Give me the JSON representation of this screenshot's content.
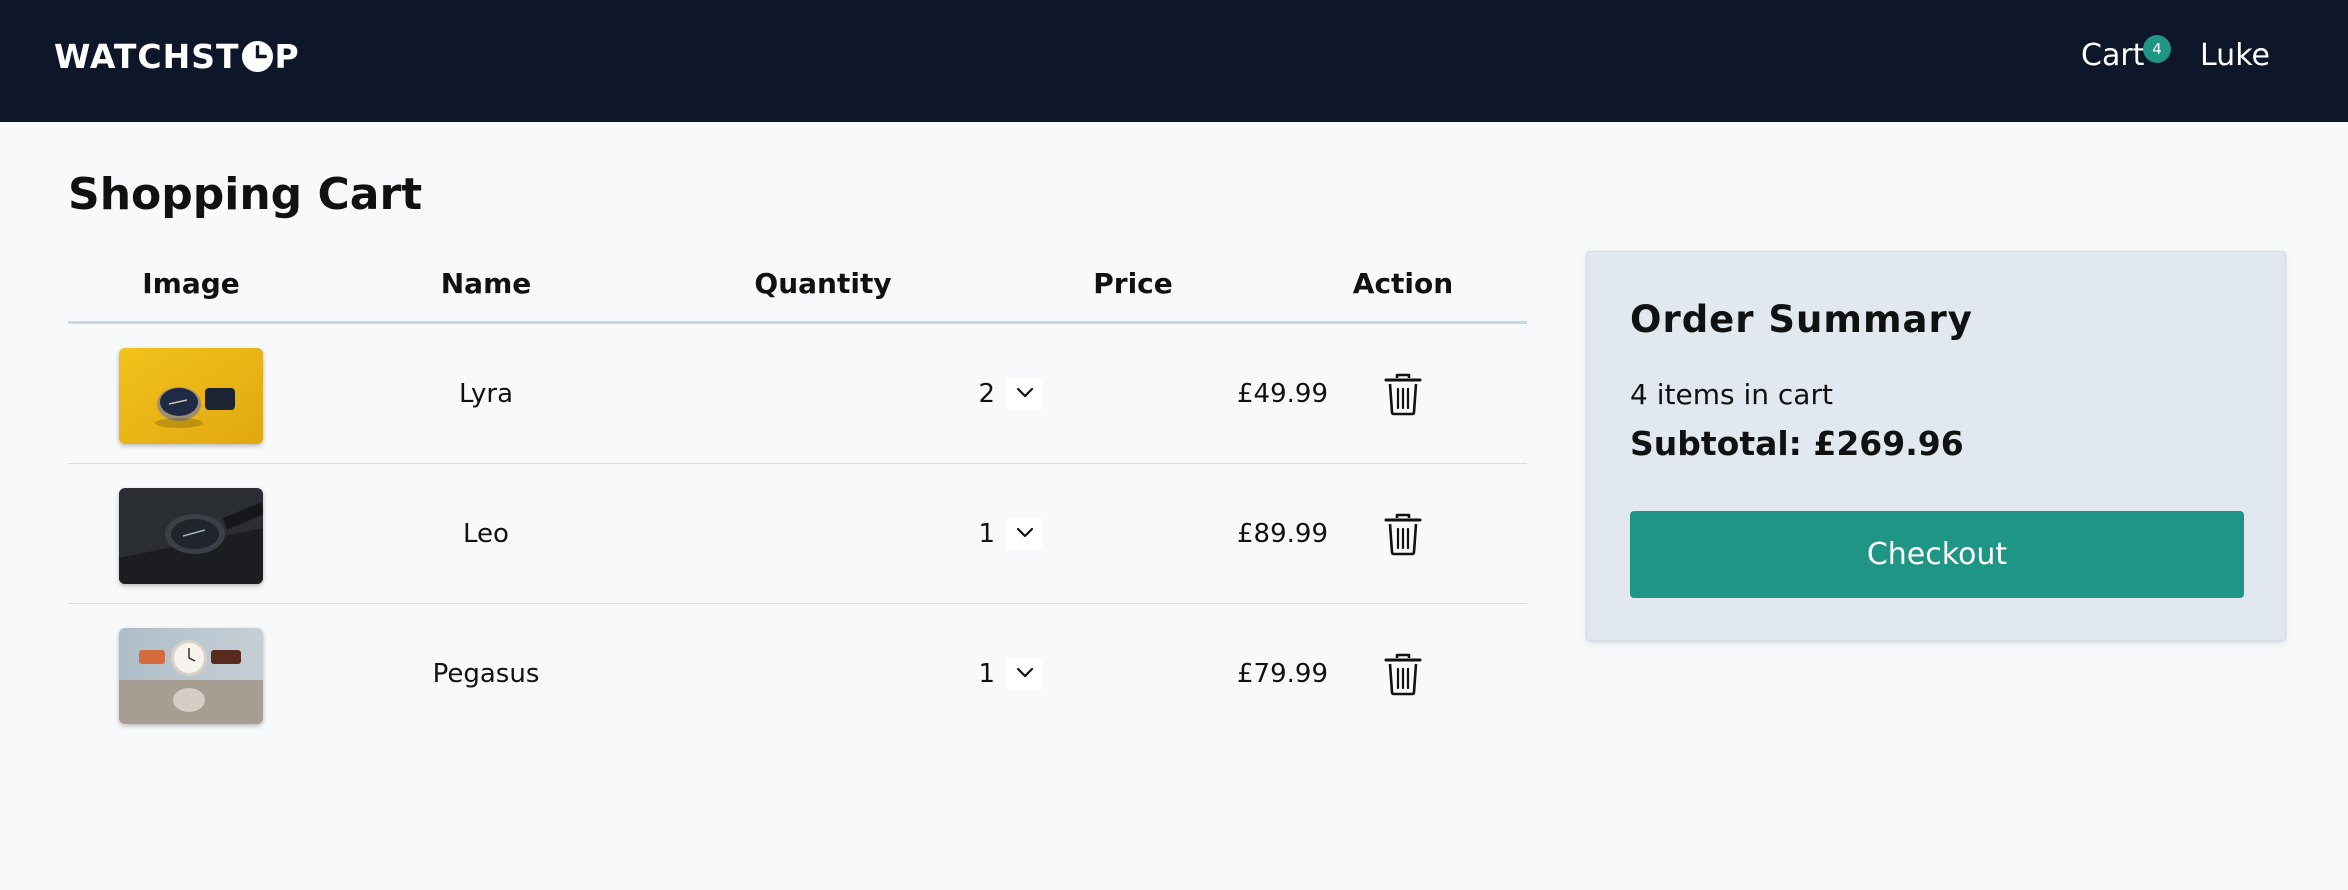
{
  "nav": {
    "logo_prefix": "WATCHST",
    "logo_suffix": "P",
    "cart_label": "Cart",
    "cart_count": "4",
    "user_name": "Luke",
    "badge_color": "#1f9585"
  },
  "page": {
    "title": "Shopping Cart"
  },
  "table": {
    "headers": {
      "image": "Image",
      "name": "Name",
      "quantity": "Quantity",
      "price": "Price",
      "action": "Action"
    },
    "rows": [
      {
        "name": "Lyra",
        "quantity": "2",
        "price": "£49.99",
        "image_icon": "watch-yellow-background"
      },
      {
        "name": "Leo",
        "quantity": "1",
        "price": "£89.99",
        "image_icon": "watch-dark-background"
      },
      {
        "name": "Pegasus",
        "quantity": "1",
        "price": "£79.99",
        "image_icon": "watch-leather-strap"
      }
    ],
    "action_icon": "trash-icon"
  },
  "summary": {
    "title": "Order Summary",
    "items_text": "4 items in cart",
    "subtotal_text": "Subtotal: £269.96",
    "checkout_label": "Checkout",
    "accent_color": "#1f9585"
  }
}
